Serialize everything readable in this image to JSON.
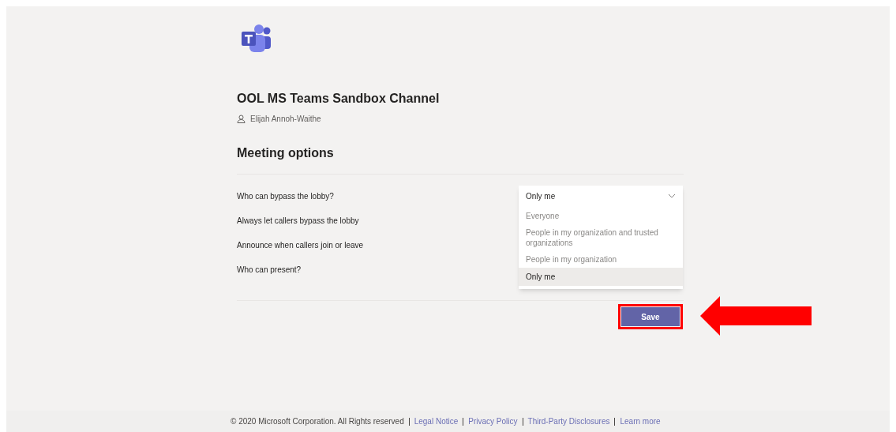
{
  "header": {
    "channel_title": "OOL MS Teams Sandbox Channel",
    "organizer": "Elijah Annoh-Waithe"
  },
  "section_title": "Meeting options",
  "options": [
    {
      "label": "Who can bypass the lobby?"
    },
    {
      "label": "Always let callers bypass the lobby"
    },
    {
      "label": "Announce when callers join or leave"
    },
    {
      "label": "Who can present?"
    }
  ],
  "dropdown": {
    "value": "Only me",
    "expanded": true,
    "items": [
      {
        "label": "Everyone",
        "selected": false
      },
      {
        "label": "People in my organization and trusted organizations",
        "selected": false
      },
      {
        "label": "People in my organization",
        "selected": false
      },
      {
        "label": "Only me",
        "selected": true
      }
    ]
  },
  "save_button": {
    "label": "Save",
    "highlighted": true
  },
  "callout_arrow": true,
  "footer": {
    "copyright": "© 2020 Microsoft Corporation. All Rights reserved",
    "links": [
      "Legal Notice",
      "Privacy Policy",
      "Third-Party Disclosures",
      "Learn more"
    ]
  }
}
